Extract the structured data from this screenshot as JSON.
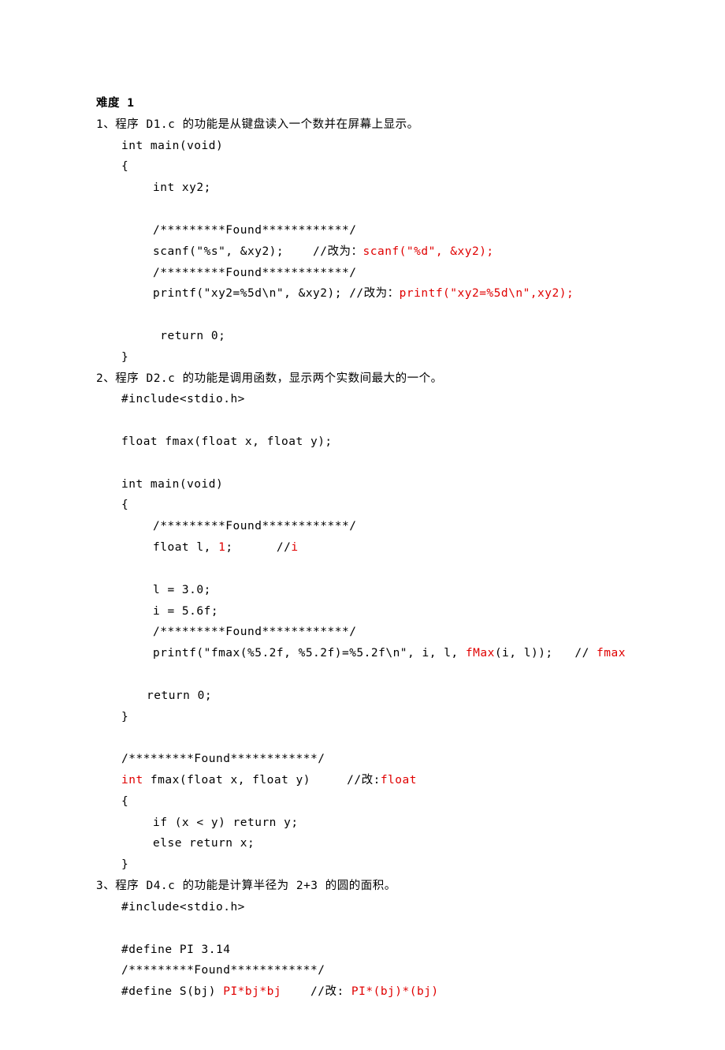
{
  "heading": "难度 1",
  "section1": {
    "title": "1、程序 D1.c 的功能是从键盘读入一个数并在屏幕上显示。",
    "lines": {
      "a": "int main(void)",
      "b": "{",
      "c": "int xy2;",
      "d": "/*********Found************/",
      "e_pre": "scanf(\"%s\", &xy2);    //改为：",
      "e_red": "scanf(\"%d\", &xy2);",
      "f": "/*********Found************/",
      "g_pre": "printf(\"xy2=%5d\\n\", &xy2); //改为：",
      "g_red": "printf(\"xy2=%5d\\n\",xy2);",
      "h": " return 0;",
      "i": "}"
    }
  },
  "section2": {
    "title": "2、程序 D2.c 的功能是调用函数，显示两个实数间最大的一个。",
    "lines": {
      "a": "#include<stdio.h>",
      "b": "float fmax(float x, float y);",
      "c": "int main(void)",
      "d": "{",
      "e": "/*********Found************/",
      "f_pre": "float l, ",
      "f_red1": "1",
      "f_mid": ";      //",
      "f_red2": "i",
      "g": "l = 3.0;",
      "h": "i = 5.6f;",
      "i": "/*********Found************/",
      "j_pre": "printf(\"fmax(%5.2f, %5.2f)=%5.2f\\n\", i, l, ",
      "j_red1": "fMax",
      "j_mid": "(i, l));   // ",
      "j_red2": "fmax",
      "k": "return 0;",
      "l": "}",
      "m": "/*********Found************/",
      "n_red": "int",
      "n_mid": " fmax(float x, float y)     //改:",
      "n_red2": "float",
      "o": "{",
      "p": "if (x < y) return y;",
      "q": "else return x;",
      "r": "}"
    }
  },
  "section3": {
    "title": "3、程序 D4.c 的功能是计算半径为 2+3 的圆的面积。",
    "lines": {
      "a": "#include<stdio.h>",
      "b": "#define PI 3.14",
      "c": "/*********Found************/",
      "d_pre": "#define S(bj) ",
      "d_red1": "PI*bj*bj",
      "d_mid": "    //改: ",
      "d_red2": "PI*(bj)*(bj)"
    }
  }
}
